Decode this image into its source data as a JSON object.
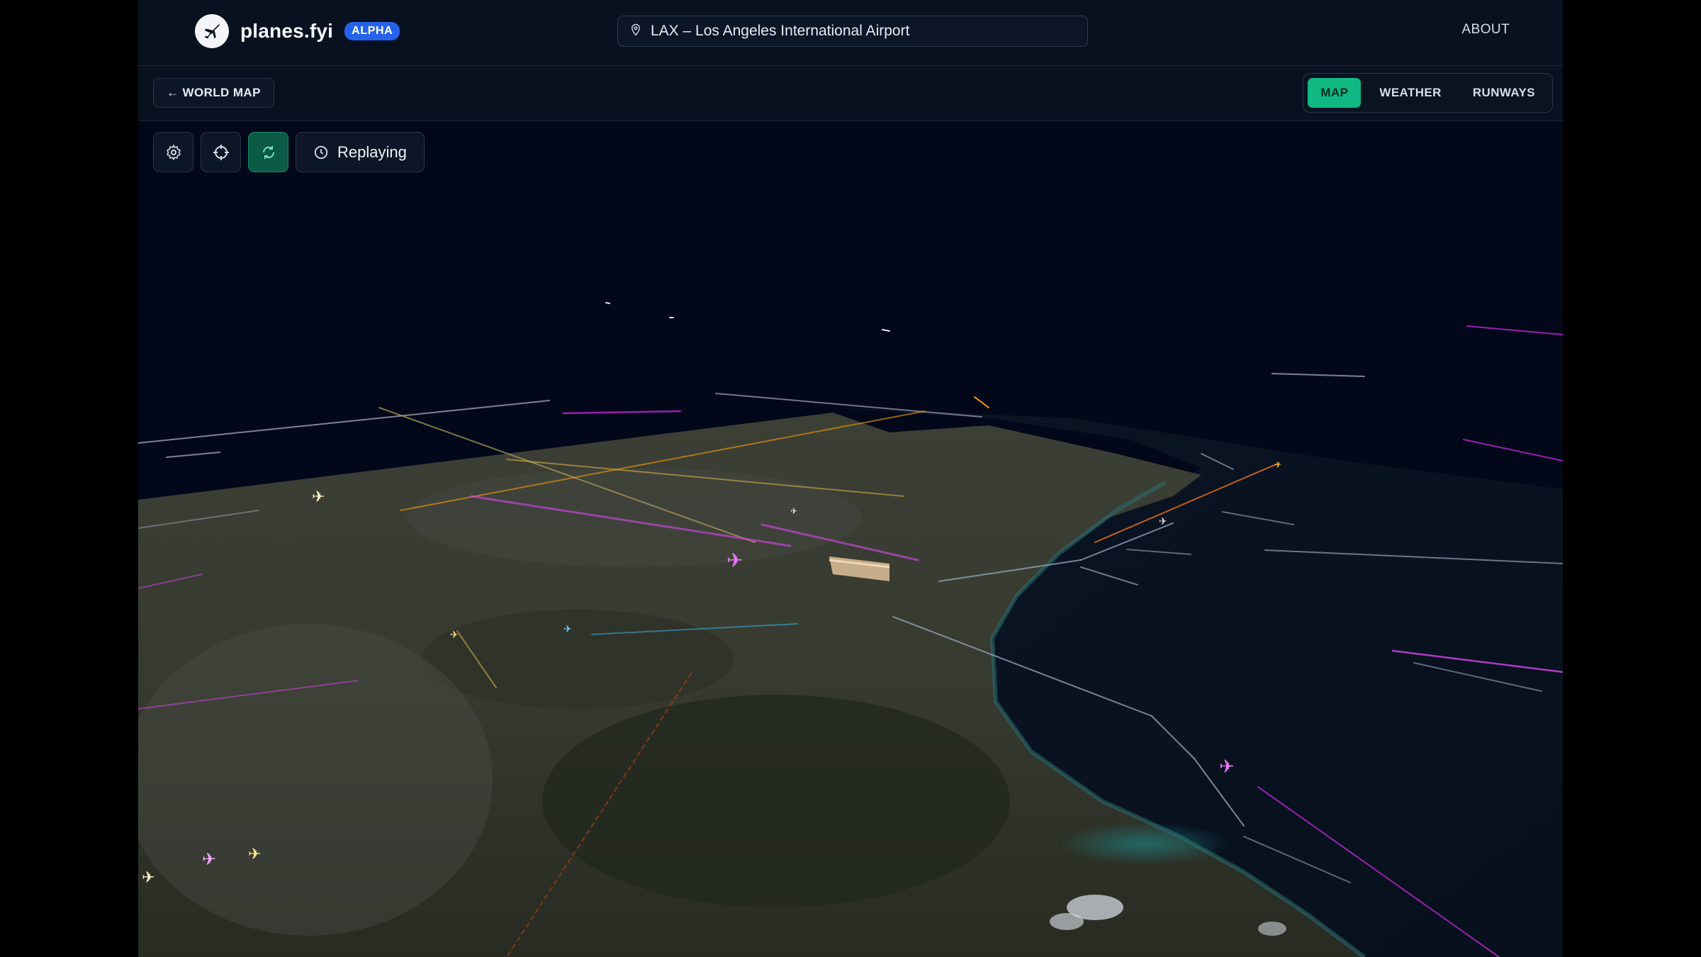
{
  "header": {
    "brand_name": "planes.fyi",
    "badge": "ALPHA",
    "search_value": "LAX – Los Angeles International Airport",
    "about_label": "ABOUT"
  },
  "subbar": {
    "back_label": "← WORLD MAP",
    "tabs": [
      {
        "label": "MAP",
        "active": true
      },
      {
        "label": "WEATHER",
        "active": false
      },
      {
        "label": "RUNWAYS",
        "active": false
      }
    ]
  },
  "toolbar": {
    "settings_icon": "gear-icon",
    "locate_icon": "crosshair-icon",
    "refresh_icon": "refresh-icon",
    "replay_label": "Replaying",
    "replay_icon": "clock-icon"
  },
  "map": {
    "view": "3D satellite terrain of Los Angeles coastline with live flight tracks",
    "colors": {
      "accent": "#10b981",
      "badge": "#2563eb",
      "track_pink": "#d946ef",
      "track_orange": "#f59e0b",
      "track_grey": "#9ca3af",
      "ocean": "#050c18"
    }
  }
}
